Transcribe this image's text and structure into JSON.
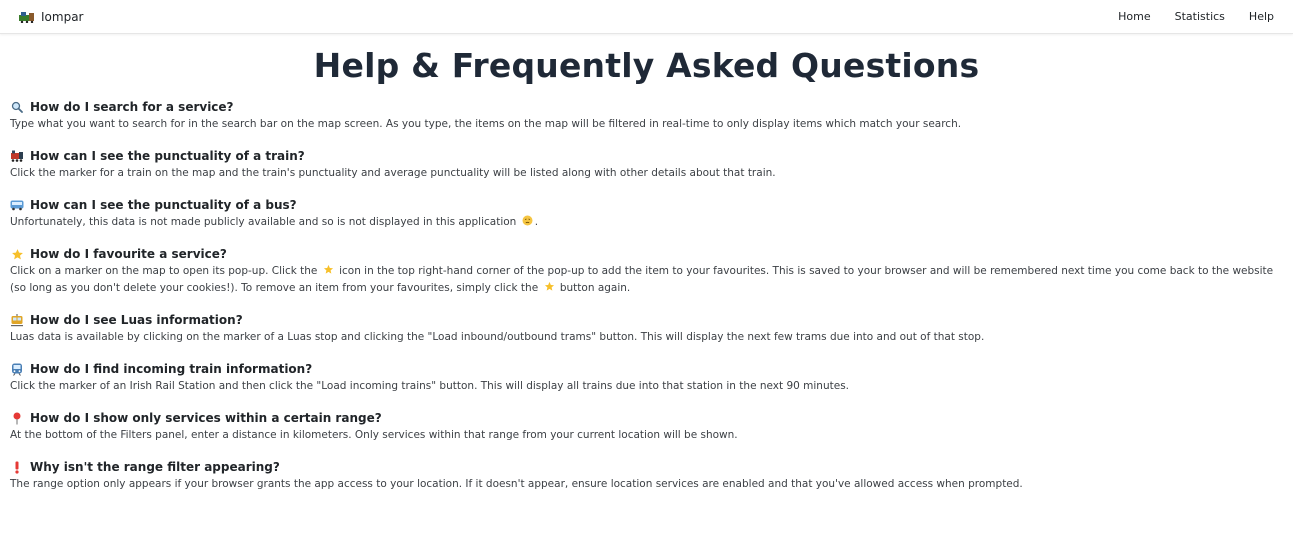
{
  "navbar": {
    "brand": "Iompar",
    "brand_icon": "train-icon",
    "links": [
      "Home",
      "Statistics",
      "Help"
    ]
  },
  "page_title": "Help & Frequently Asked Questions",
  "faq": [
    {
      "icon": "search-icon",
      "question": "How do I search for a service?",
      "answer": "Type what you want to search for in the search bar on the map screen. As you type, the items on the map will be filtered in real-time to only display items which match your search."
    },
    {
      "icon": "train-icon",
      "question": "How can I see the punctuality of a train?",
      "answer": "Click the marker for a train on the map and the train's punctuality and average punctuality will be listed along with other details about that train."
    },
    {
      "icon": "bus-icon",
      "question": "How can I see the punctuality of a bus?",
      "answer_pre": "Unfortunately, this data is not made publicly available and so is not displayed in this application",
      "answer_post": "."
    },
    {
      "icon": "star-icon",
      "question": "How do I favourite a service?",
      "answer_1": "Click on a marker on the map to open its pop-up. Click the",
      "answer_2": "icon in the top right-hand corner of the pop-up to add the item to your favourites. This is saved to your browser and will be remembered next time you come back to the website (so long as you don't delete your cookies!). To remove an item from your favourites, simply click the",
      "answer_3": "button again."
    },
    {
      "icon": "tram-icon",
      "question": "How do I see Luas information?",
      "answer": "Luas data is available by clicking on the marker of a Luas stop and clicking the \"Load inbound/outbound trams\" button. This will display the next few trams due into and out of that stop."
    },
    {
      "icon": "metro-icon",
      "question": "How do I find incoming train information?",
      "answer": "Click the marker of an Irish Rail Station and then click the \"Load incoming trains\" button. This will display all trains due into that station in the next 90 minutes."
    },
    {
      "icon": "pin-icon",
      "question": "How do I show only services within a certain range?",
      "answer": "At the bottom of the Filters panel, enter a distance in kilometers. Only services within that range from your current location will be shown."
    },
    {
      "icon": "exclamation-icon",
      "question": "Why isn't the range filter appearing?",
      "answer": "The range option only appears if your browser grants the app access to your location. If it doesn't appear, ensure location services are enabled and that you've allowed access when prompted."
    }
  ]
}
